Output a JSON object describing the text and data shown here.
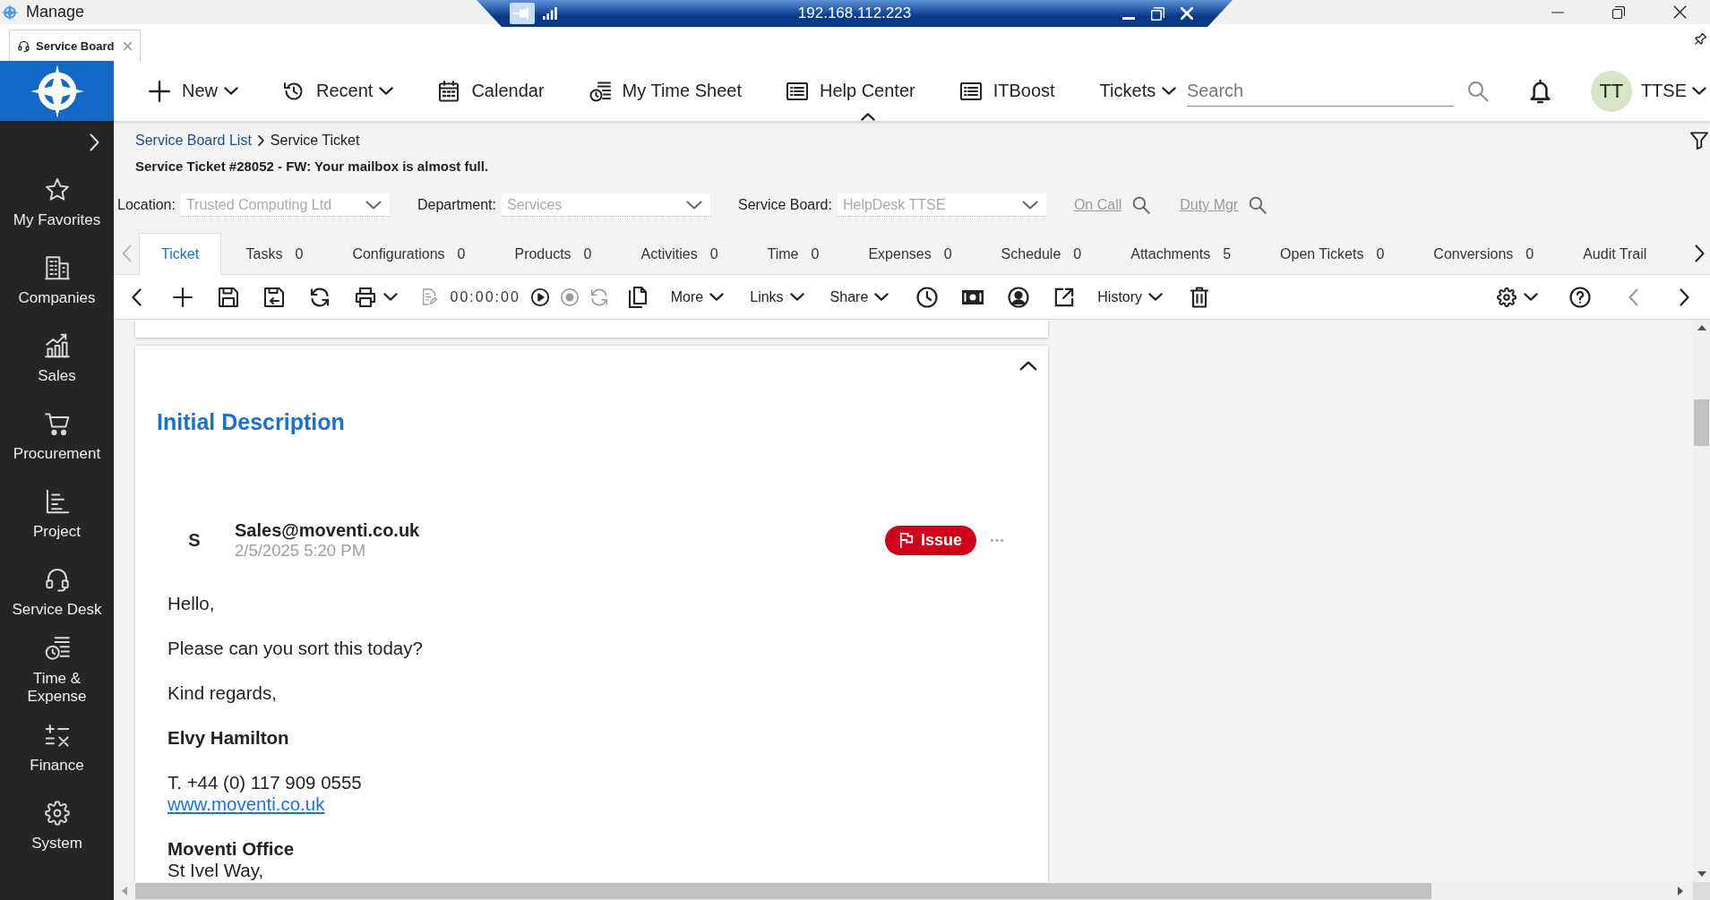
{
  "window": {
    "title": "Manage",
    "remote_address": "192.168.112.223"
  },
  "app_tabs": [
    {
      "label": "Service Board",
      "selected": true
    }
  ],
  "header": {
    "nav": [
      {
        "label": "New",
        "kind": "menu"
      },
      {
        "label": "Recent",
        "kind": "menu"
      },
      {
        "label": "Calendar",
        "kind": "link"
      },
      {
        "label": "My Time Sheet",
        "kind": "link"
      },
      {
        "label": "Help Center",
        "kind": "link"
      },
      {
        "label": "ITBoost",
        "kind": "link"
      },
      {
        "label": "Tickets",
        "kind": "menu"
      }
    ],
    "search": {
      "placeholder": "Search"
    },
    "user": {
      "initials": "TT",
      "name": "TTSE"
    }
  },
  "sidebar": {
    "items": [
      {
        "label": "My Favorites"
      },
      {
        "label": "Companies"
      },
      {
        "label": "Sales"
      },
      {
        "label": "Procurement"
      },
      {
        "label": "Project"
      },
      {
        "label": "Service Desk"
      },
      {
        "label": "Time & Expense"
      },
      {
        "label": "Finance"
      },
      {
        "label": "System"
      }
    ]
  },
  "breadcrumb": [
    {
      "label": "Service Board List",
      "kind": "link"
    },
    {
      "label": "Service Ticket",
      "kind": "current"
    }
  ],
  "ticket_title": "Service Ticket #28052 - FW: Your mailbox is almost full.",
  "fields": [
    {
      "label": "Location:",
      "value": "Trusted Computing Ltd",
      "disabled": true
    },
    {
      "label": "Department:",
      "value": "Services",
      "disabled": true
    },
    {
      "label": "Service Board:",
      "value": "HelpDesk TTSE",
      "disabled": true
    }
  ],
  "lookups": [
    {
      "label": "On Call",
      "disabled": true
    },
    {
      "label": "Duty Mgr",
      "disabled": true
    }
  ],
  "tabs": [
    {
      "label": "Ticket",
      "selected": true
    },
    {
      "label": "Tasks",
      "count": "0",
      "selected": false
    },
    {
      "label": "Configurations",
      "count": "0",
      "selected": false
    },
    {
      "label": "Products",
      "count": "0",
      "selected": false
    },
    {
      "label": "Activities",
      "count": "0",
      "selected": false
    },
    {
      "label": "Time",
      "count": "0",
      "selected": false
    },
    {
      "label": "Expenses",
      "count": "0",
      "selected": false
    },
    {
      "label": "Schedule",
      "count": "0",
      "selected": false
    },
    {
      "label": "Attachments",
      "count": "5",
      "selected": false
    },
    {
      "label": "Open Tickets",
      "count": "0",
      "selected": false
    },
    {
      "label": "Conversions",
      "count": "0",
      "selected": false
    },
    {
      "label": "Audit Trail",
      "selected": false
    }
  ],
  "toolbar": {
    "timer": "00:00:00",
    "menus": [
      "More",
      "Links",
      "Share"
    ],
    "history_menu": "History"
  },
  "description": {
    "title": "Initial Description",
    "message": {
      "initial": "S",
      "sender": "Sales@moventi.co.uk",
      "date": "2/5/2025 5:20 PM",
      "tag": "Issue",
      "body": [
        {
          "lines": [
            {
              "kind": "text",
              "text": "Hello,"
            }
          ]
        },
        {
          "lines": [
            {
              "kind": "text",
              "text": "Please can you sort this today?"
            }
          ]
        },
        {
          "lines": [
            {
              "kind": "text",
              "text": "Kind regards,"
            }
          ]
        },
        {
          "lines": [
            {
              "kind": "bold",
              "text": "Elvy Hamilton"
            }
          ]
        },
        {
          "lines": [
            {
              "kind": "text",
              "text": "T. +44 (0) 117 909 0555"
            },
            {
              "kind": "link",
              "text": "www.moventi.co.uk"
            }
          ]
        },
        {
          "lines": [
            {
              "kind": "bold",
              "text": "Moventi Office"
            },
            {
              "kind": "text",
              "text": "St Ivel Way,"
            }
          ]
        }
      ]
    }
  }
}
